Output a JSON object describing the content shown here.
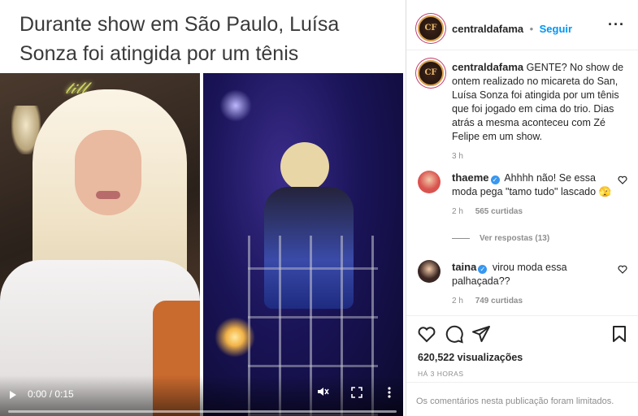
{
  "headline": "Durante show em São Paulo, Luísa Sonza foi atingida por um tênis",
  "video": {
    "time": "0:00 / 0:15",
    "progress": 0.0,
    "icons": [
      "play-icon",
      "mute-icon",
      "fullscreen-icon",
      "more-vertical-icon"
    ]
  },
  "header": {
    "username": "centraldafama",
    "separator": "•",
    "follow_label": "Seguir",
    "more_label": "···"
  },
  "caption": {
    "username": "centraldafama",
    "text": "GENTE? No show de ontem realizado no micareta do San, Luísa Sonza foi atingida por um tênis que foi jogado em cima do trio. Dias atrás a mesma aconteceu com Zé Felipe em um show.",
    "time": "3 h"
  },
  "comments": [
    {
      "username": "thaeme",
      "verified_mark": "✓",
      "text": "Ahhhh não! Se essa moda pega \"tamo tudo\" lascado 🫣",
      "time": "2 h",
      "likes": "565 curtidas",
      "replies": "Ver respostas (13)",
      "avatar_color": "#d9534f"
    },
    {
      "username": "taina",
      "verified_mark": "✓",
      "text": "virou moda essa palhaçada??",
      "time": "2 h",
      "likes": "749 curtidas",
      "avatar_color": "#3a2622"
    }
  ],
  "actions": {
    "icons": [
      "heart-icon",
      "comment-icon",
      "share-icon",
      "save-icon"
    ]
  },
  "views": "620,522 visualizações",
  "posted_ago": "HÁ 3 HORAS",
  "comments_limited": "Os comentários nesta publicação foram limitados.",
  "colors": {
    "accent": "#0095f6",
    "verified": "#3897f0",
    "muted": "#8e8e8e",
    "text": "#262626"
  }
}
